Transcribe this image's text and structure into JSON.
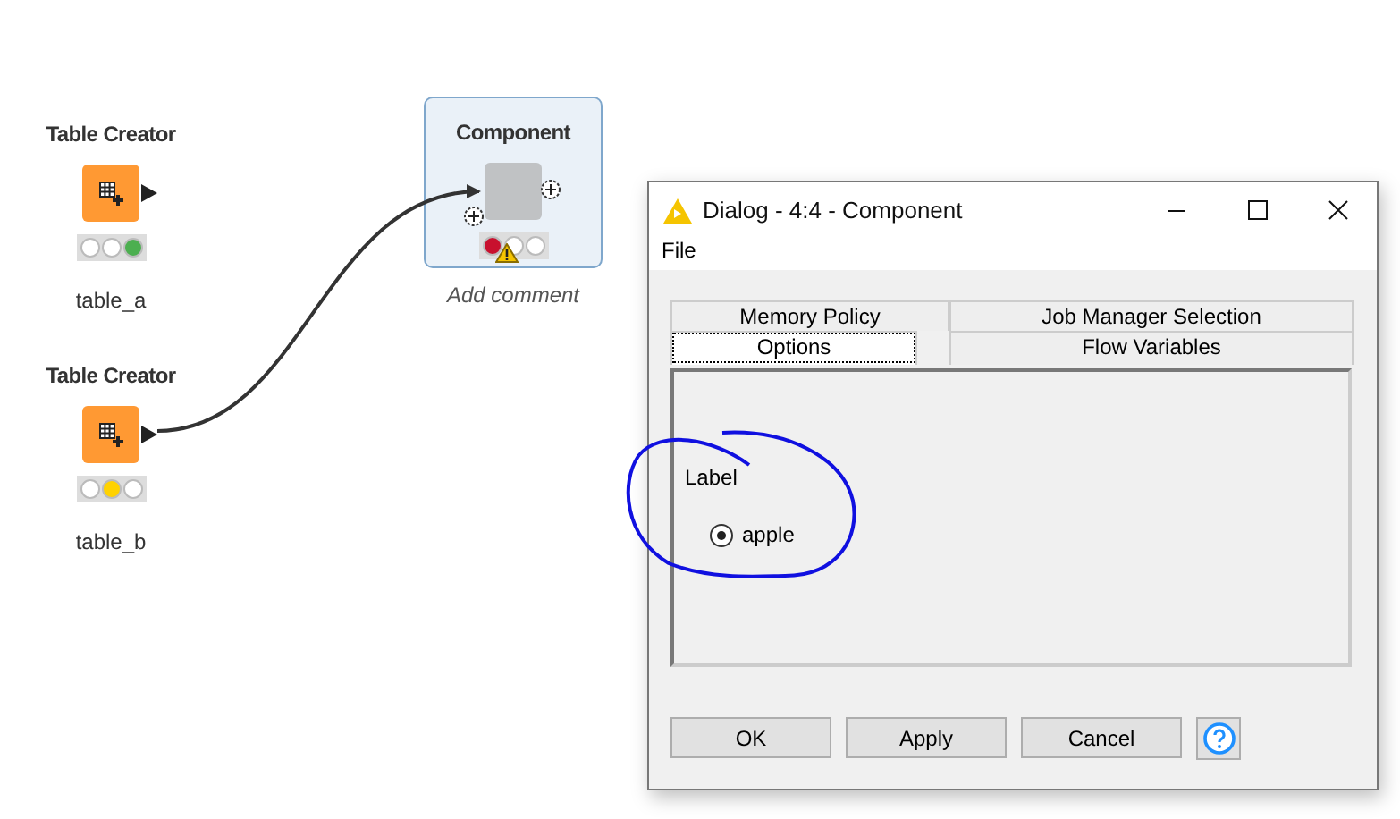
{
  "canvas": {
    "nodes": [
      {
        "kind": "source",
        "title": "Table Creator",
        "lights": [
          {
            "color": "#ffffff"
          },
          {
            "color": "#ffffff"
          },
          {
            "color": "#4caf50"
          }
        ],
        "label": "table_a"
      },
      {
        "kind": "source",
        "title": "Table Creator",
        "lights": [
          {
            "color": "#ffffff"
          },
          {
            "color": "#ffd200"
          },
          {
            "color": "#ffffff"
          }
        ],
        "label": "table_b"
      },
      {
        "kind": "component",
        "title": "Component",
        "lights": [
          {
            "color": "#c8102e"
          },
          {
            "color": "#ffffff"
          },
          {
            "color": "#ffffff"
          }
        ],
        "label": "Add comment",
        "warning": true
      }
    ]
  },
  "dialog": {
    "title": "Dialog - 4:4 - Component",
    "menu": [
      "File"
    ],
    "tabs": [
      [
        {
          "label": "Memory Policy",
          "selected": false
        },
        {
          "label": "Job Manager Selection",
          "selected": false
        }
      ],
      [
        {
          "label": "Options",
          "selected": true
        },
        {
          "label": "Flow Variables",
          "selected": false
        }
      ]
    ],
    "field_label": "Label",
    "options": [
      {
        "label": "apple",
        "selected": true
      }
    ],
    "buttons": [
      "OK",
      "Apply",
      "Cancel"
    ]
  }
}
